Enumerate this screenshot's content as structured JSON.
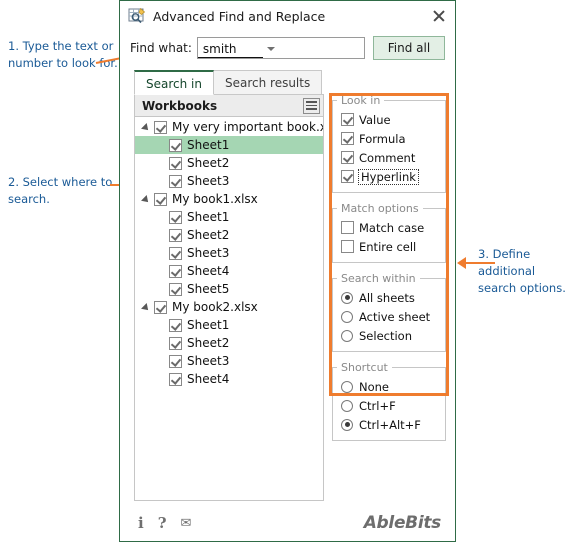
{
  "annotations": [
    {
      "id": "annot-1",
      "text": "1. Type the text or number to look for."
    },
    {
      "id": "annot-2",
      "text": "2. Select where to search."
    },
    {
      "id": "annot-3",
      "text": "3. Define additional search options."
    }
  ],
  "dialog": {
    "title": "Advanced Find and Replace",
    "title_icon": "find-replace-grid-icon",
    "close_icon": "close-icon",
    "find": {
      "label": "Find what:",
      "value": "smith",
      "placeholder": "",
      "dropdown_icon": "chevron-down-icon",
      "button_label": "Find all"
    },
    "tabs": [
      {
        "label": "Search in",
        "active": true
      },
      {
        "label": "Search results",
        "active": false
      }
    ],
    "tree": {
      "header": "Workbooks",
      "menu_icon": "hamburger-icon",
      "nodes": [
        {
          "level": "book",
          "label": "My very important book.xlsx",
          "checked": true,
          "selected": false,
          "expanded": true
        },
        {
          "level": "sheet",
          "label": "Sheet1",
          "checked": true,
          "selected": true
        },
        {
          "level": "sheet",
          "label": "Sheet2",
          "checked": true,
          "selected": false
        },
        {
          "level": "sheet",
          "label": "Sheet3",
          "checked": true,
          "selected": false
        },
        {
          "level": "book",
          "label": "My book1.xlsx",
          "checked": true,
          "selected": false,
          "expanded": true
        },
        {
          "level": "sheet",
          "label": "Sheet1",
          "checked": true,
          "selected": false
        },
        {
          "level": "sheet",
          "label": "Sheet2",
          "checked": true,
          "selected": false
        },
        {
          "level": "sheet",
          "label": "Sheet3",
          "checked": true,
          "selected": false
        },
        {
          "level": "sheet",
          "label": "Sheet4",
          "checked": true,
          "selected": false
        },
        {
          "level": "sheet",
          "label": "Sheet5",
          "checked": true,
          "selected": false
        },
        {
          "level": "book",
          "label": "My book2.xlsx",
          "checked": true,
          "selected": false,
          "expanded": true
        },
        {
          "level": "sheet",
          "label": "Sheet1",
          "checked": true,
          "selected": false
        },
        {
          "level": "sheet",
          "label": "Sheet2",
          "checked": true,
          "selected": false
        },
        {
          "level": "sheet",
          "label": "Sheet3",
          "checked": true,
          "selected": false
        },
        {
          "level": "sheet",
          "label": "Sheet4",
          "checked": true,
          "selected": false
        }
      ]
    },
    "options": {
      "look_in": {
        "legend": "Look in",
        "items": [
          {
            "label": "Value",
            "checked": true,
            "focused": false
          },
          {
            "label": "Formula",
            "checked": true,
            "focused": false
          },
          {
            "label": "Comment",
            "checked": true,
            "focused": false
          },
          {
            "label": "Hyperlink",
            "checked": true,
            "focused": true
          }
        ]
      },
      "match_options": {
        "legend": "Match options",
        "items": [
          {
            "label": "Match case",
            "checked": false
          },
          {
            "label": "Entire cell",
            "checked": false
          }
        ]
      },
      "search_within": {
        "legend": "Search within",
        "items": [
          {
            "label": "All sheets",
            "selected": true
          },
          {
            "label": "Active sheet",
            "selected": false
          },
          {
            "label": "Selection",
            "selected": false
          }
        ]
      },
      "shortcut": {
        "legend": "Shortcut",
        "items": [
          {
            "label": "None",
            "selected": false
          },
          {
            "label": "Ctrl+F",
            "selected": false
          },
          {
            "label": "Ctrl+Alt+F",
            "selected": true
          }
        ]
      }
    },
    "footer": {
      "info_icon": "info-icon",
      "info_glyph": "i",
      "help_icon": "help-icon",
      "help_glyph": "?",
      "mail_icon": "mail-icon",
      "mail_glyph": "✉",
      "brand": "AbleBits"
    }
  },
  "colors": {
    "accent_green": "#2f6b46",
    "highlight_green": "#a5d6b3",
    "button_green": "#e3efe5",
    "annotation_orange": "#ef7c2e",
    "annotation_blue": "#1a5a96"
  }
}
